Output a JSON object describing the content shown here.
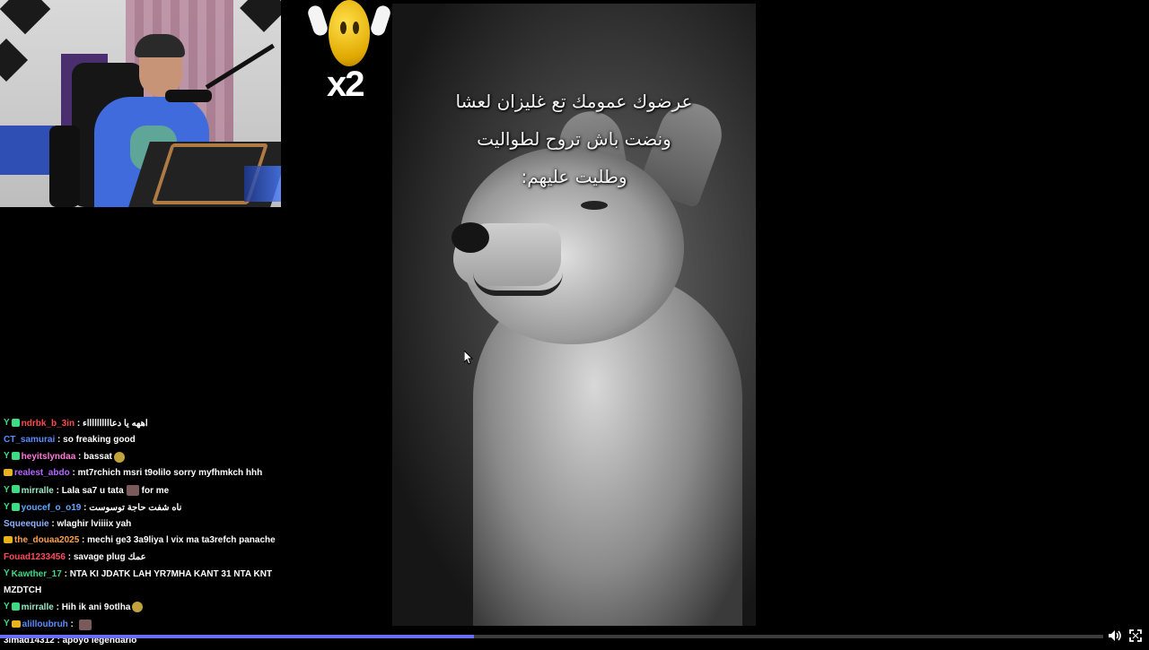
{
  "emote": {
    "multiplier": "x2",
    "icon": "waving-emoji-icon"
  },
  "video": {
    "caption_lines": [
      "عرضوك عمومك تع غليزان لعشا",
      "ونضت باش تروح لطواليت",
      "وطليت عليهم:"
    ]
  },
  "chat": {
    "messages": [
      {
        "badges": [
          "y",
          "sq"
        ],
        "user": "ndrbk_b_3in",
        "color": "#ff4b4b",
        "text": "اههه يا دعااااااااااء"
      },
      {
        "badges": [],
        "user": "CT_samurai",
        "color": "#5b8cff",
        "text": "so freaking good"
      },
      {
        "badges": [
          "y",
          "sq"
        ],
        "user": "heyitslyndaa",
        "color": "#ff7ad9",
        "text": "bassat",
        "emote": "round"
      },
      {
        "badges": [
          "crown"
        ],
        "user": "realest_abdo",
        "color": "#b266ff",
        "text": "mt7rchich msri t9olilo sorry myfhmkch hhh"
      },
      {
        "badges": [
          "y",
          "sq"
        ],
        "user": "mirralle",
        "color": "#9be6c8",
        "text": "Lala sa7 u tata",
        "emote": "box",
        "text2": "for me"
      },
      {
        "badges": [
          "y",
          "sq"
        ],
        "user": "youcef_o_o19",
        "color": "#5fa8ff",
        "text": "ناه شفت حاجة توسوست"
      },
      {
        "badges": [],
        "user": "Squeequie",
        "color": "#8fb0ff",
        "text": "wlaghir lviiiix yah"
      },
      {
        "badges": [
          "crown"
        ],
        "user": "the_douaa2025",
        "color": "#ffa24b",
        "text": "mechi ge3 3a9liya l vix ma ta3refch panache"
      },
      {
        "badges": [],
        "user": "Fouad1233456",
        "color": "#ff4b5c",
        "text": "savage plug عمك"
      },
      {
        "badges": [
          "y"
        ],
        "user": "Kawther_17",
        "color": "#3ddc84",
        "text": "NTA KI JDATK LAH YR7MHA KANT 31 NTA KNT MZDTCH"
      },
      {
        "badges": [
          "y",
          "sq"
        ],
        "user": "mirralle",
        "color": "#9be6c8",
        "text": "Hih ik ani 9otlha",
        "emote": "round"
      },
      {
        "badges": [
          "y",
          "crown"
        ],
        "user": "alilloubruh",
        "color": "#5b8cff",
        "text": "",
        "emote": "box"
      },
      {
        "badges": [],
        "user": "3imad14312",
        "color": "#ffffff",
        "text": "apoyo legendario"
      }
    ]
  },
  "player": {
    "progress": 0.43,
    "volume_icon": "volume-icon",
    "fullscreen_icon": "fullscreen-icon"
  }
}
